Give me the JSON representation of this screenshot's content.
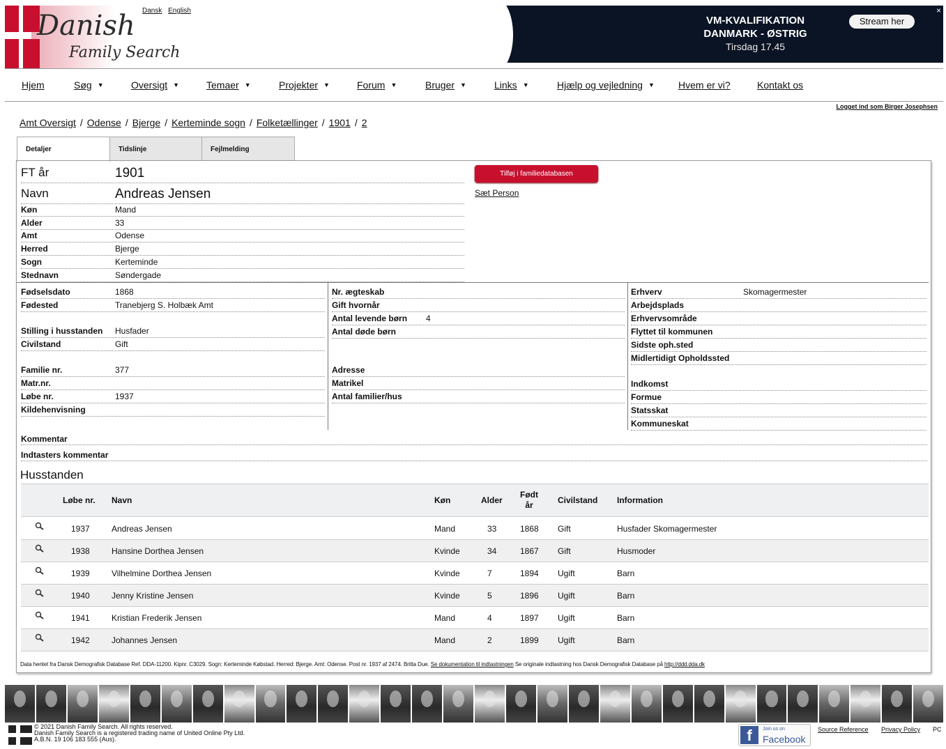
{
  "header": {
    "logo_line1": "Danish",
    "logo_line2": "Family Search",
    "lang_dansk": "Dansk",
    "lang_english": "English",
    "banner_title": "VM-KVALIFIKATION DANMARK - ØSTRIG",
    "banner_date": "Tirsdag 17.45",
    "banner_button": "Stream her",
    "banner_close": "×"
  },
  "nav": {
    "items": [
      "Hjem",
      "Søg",
      "Oversigt",
      "Temaer",
      "Projekter",
      "Forum",
      "Bruger",
      "Links",
      "Hjælp og vejledning",
      "Hvem er vi?",
      "Kontakt os"
    ],
    "caret": "▼"
  },
  "logged_in": "Logget ind som Birger Josephsen",
  "breadcrumb": [
    "Amt Oversigt",
    "Odense",
    "Bjerge",
    "Kerteminde sogn",
    "Folketællinger",
    "1901",
    "2"
  ],
  "breadcrumb_sep": "/",
  "tabs": [
    "Detaljer",
    "Tidslinje",
    "Fejlmelding"
  ],
  "actions": {
    "add_button": "Tilføj i familiedatabasen",
    "set_person": "Sæt Person"
  },
  "top_fields": [
    {
      "label": "FT år",
      "value": "1901"
    },
    {
      "label": "Navn",
      "value": "Andreas Jensen"
    },
    {
      "label": "Køn",
      "value": "Mand"
    },
    {
      "label": "Alder",
      "value": "33"
    },
    {
      "label": "Amt",
      "value": "Odense"
    },
    {
      "label": "Herred",
      "value": "Bjerge"
    },
    {
      "label": "Sogn",
      "value": "Kerteminde"
    },
    {
      "label": "Stednavn",
      "value": "Søndergade"
    }
  ],
  "col1": [
    {
      "label": "Fødselsdato",
      "value": "1868"
    },
    {
      "label": "Fødested",
      "value": "Tranebjerg S. Holbæk Amt"
    },
    {
      "label": "Stilling i husstanden",
      "value": "Husfader"
    },
    {
      "label": "Civilstand",
      "value": "Gift"
    },
    {
      "label": "Familie nr.",
      "value": "377"
    },
    {
      "label": "Matr.nr.",
      "value": ""
    },
    {
      "label": "Løbe nr.",
      "value": "1937"
    },
    {
      "label": "Kildehenvisning",
      "value": ""
    }
  ],
  "col2": [
    {
      "label": "Nr. ægteskab",
      "value": ""
    },
    {
      "label": "Gift hvornår",
      "value": ""
    },
    {
      "label": "Antal levende børn",
      "value": "4"
    },
    {
      "label": "Antal døde børn",
      "value": ""
    },
    {
      "label": "Adresse",
      "value": ""
    },
    {
      "label": "Matrikel",
      "value": ""
    },
    {
      "label": "Antal familier/hus",
      "value": ""
    }
  ],
  "col3": [
    {
      "label": "Erhverv",
      "value": "Skomagermester"
    },
    {
      "label": "Arbejdsplads",
      "value": ""
    },
    {
      "label": "Erhvervsområde",
      "value": ""
    },
    {
      "label": "Flyttet til kommunen",
      "value": ""
    },
    {
      "label": "Sidste oph.sted",
      "value": ""
    },
    {
      "label": "Midlertidigt Opholdssted",
      "value": ""
    },
    {
      "label": "Indkomst",
      "value": ""
    },
    {
      "label": "Formue",
      "value": ""
    },
    {
      "label": "Statsskat",
      "value": ""
    },
    {
      "label": "Kommuneskat",
      "value": ""
    }
  ],
  "comments": {
    "kommentar": "Kommentar",
    "indtasters": "Indtasters kommentar"
  },
  "household": {
    "title": "Husstanden",
    "headers": {
      "lobenr": "Løbe nr.",
      "navn": "Navn",
      "kon": "Køn",
      "alder": "Alder",
      "fodt": "Født år",
      "civil": "Civilstand",
      "info": "Information"
    },
    "rows": [
      {
        "lobenr": "1937",
        "navn": "Andreas Jensen",
        "kon": "Mand",
        "alder": "33",
        "fodt": "1868",
        "civil": "Gift",
        "info": "Husfader Skomagermester"
      },
      {
        "lobenr": "1938",
        "navn": "Hansine Dorthea Jensen",
        "kon": "Kvinde",
        "alder": "34",
        "fodt": "1867",
        "civil": "Gift",
        "info": "Husmoder"
      },
      {
        "lobenr": "1939",
        "navn": "Vilhelmine Dorthea Jensen",
        "kon": "Kvinde",
        "alder": "7",
        "fodt": "1894",
        "civil": "Ugift",
        "info": "Barn"
      },
      {
        "lobenr": "1940",
        "navn": "Jenny Kristine Jensen",
        "kon": "Kvinde",
        "alder": "5",
        "fodt": "1896",
        "civil": "Ugift",
        "info": "Barn"
      },
      {
        "lobenr": "1941",
        "navn": "Kristian Frederik Jensen",
        "kon": "Mand",
        "alder": "4",
        "fodt": "1897",
        "civil": "Ugift",
        "info": "Barn"
      },
      {
        "lobenr": "1942",
        "navn": "Johannes Jensen",
        "kon": "Mand",
        "alder": "2",
        "fodt": "1899",
        "civil": "Ugift",
        "info": "Barn"
      }
    ]
  },
  "source": {
    "text": "Data hentet fra Dansk Demografisk Database Ref. DDA-11200. Kipnr. C3029. Sogn: Kerteminde Købstad. Herred: Bjerge. Amt: Odense. Post nr. 1937 af 2474. Britta Due.",
    "link1": "Se dokumentation til indtastningen",
    "text2": "Se originale indtastning hos Dansk Demografisk Database på",
    "link2": "http://ddd.dda.dk"
  },
  "footer": {
    "copy1": "© 2021 Danish Family Search. All rights reserved.",
    "copy2": "Danish Family Search is a registered trading name of United Online Pty Ltd.",
    "copy3": "A.B.N. 19 106 183 555 (Aus).",
    "fb_join": "Join us on",
    "fb_name": "Facebook",
    "links": [
      "Source Reference",
      "Privacy Policy",
      "PC"
    ]
  },
  "colors": {
    "accent_red": "#c8102e",
    "facebook_blue": "#3b5998",
    "banner_bg": "#0b1424"
  }
}
